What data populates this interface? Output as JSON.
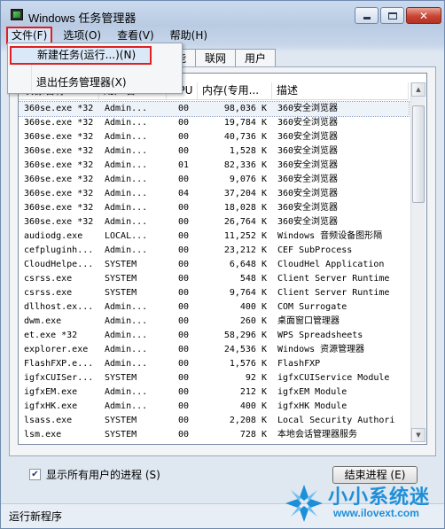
{
  "window": {
    "title": "Windows 任务管理器"
  },
  "menubar": {
    "file": "文件(F)",
    "options": "选项(O)",
    "view": "查看(V)",
    "help": "帮助(H)"
  },
  "tabs": [
    "能",
    "联网",
    "用户"
  ],
  "dropdown": {
    "new_task": "新建任务(运行...)(N)",
    "exit": "退出任务管理器(X)"
  },
  "columns": {
    "name": "映像名称",
    "user": "用户名",
    "cpu": "CPU",
    "memory": "内存(专用...",
    "description": "描述"
  },
  "processes": [
    {
      "name": "360se.exe *32",
      "user": "Admin...",
      "cpu": "00",
      "mem": "98,036 K",
      "desc": "360安全浏览器"
    },
    {
      "name": "360se.exe *32",
      "user": "Admin...",
      "cpu": "00",
      "mem": "19,784 K",
      "desc": "360安全浏览器"
    },
    {
      "name": "360se.exe *32",
      "user": "Admin...",
      "cpu": "00",
      "mem": "40,736 K",
      "desc": "360安全浏览器"
    },
    {
      "name": "360se.exe *32",
      "user": "Admin...",
      "cpu": "00",
      "mem": "1,528 K",
      "desc": "360安全浏览器"
    },
    {
      "name": "360se.exe *32",
      "user": "Admin...",
      "cpu": "01",
      "mem": "82,336 K",
      "desc": "360安全浏览器"
    },
    {
      "name": "360se.exe *32",
      "user": "Admin...",
      "cpu": "00",
      "mem": "9,076 K",
      "desc": "360安全浏览器"
    },
    {
      "name": "360se.exe *32",
      "user": "Admin...",
      "cpu": "04",
      "mem": "37,204 K",
      "desc": "360安全浏览器"
    },
    {
      "name": "360se.exe *32",
      "user": "Admin...",
      "cpu": "00",
      "mem": "18,028 K",
      "desc": "360安全浏览器"
    },
    {
      "name": "360se.exe *32",
      "user": "Admin...",
      "cpu": "00",
      "mem": "26,764 K",
      "desc": "360安全浏览器"
    },
    {
      "name": "audiodg.exe",
      "user": "LOCAL...",
      "cpu": "00",
      "mem": "11,252 K",
      "desc": "Windows 音频设备图形隔"
    },
    {
      "name": "cefpluginh...",
      "user": "Admin...",
      "cpu": "00",
      "mem": "23,212 K",
      "desc": "CEF SubProcess"
    },
    {
      "name": "CloudHelpe...",
      "user": "SYSTEM",
      "cpu": "00",
      "mem": "6,648 K",
      "desc": "CloudHel Application"
    },
    {
      "name": "csrss.exe",
      "user": "SYSTEM",
      "cpu": "00",
      "mem": "548 K",
      "desc": "Client Server Runtime"
    },
    {
      "name": "csrss.exe",
      "user": "SYSTEM",
      "cpu": "00",
      "mem": "9,764 K",
      "desc": "Client Server Runtime"
    },
    {
      "name": "dllhost.ex...",
      "user": "Admin...",
      "cpu": "00",
      "mem": "400 K",
      "desc": "COM Surrogate"
    },
    {
      "name": "dwm.exe",
      "user": "Admin...",
      "cpu": "00",
      "mem": "260 K",
      "desc": "桌面窗口管理器"
    },
    {
      "name": "et.exe *32",
      "user": "Admin...",
      "cpu": "00",
      "mem": "58,296 K",
      "desc": "WPS Spreadsheets"
    },
    {
      "name": "explorer.exe",
      "user": "Admin...",
      "cpu": "00",
      "mem": "24,536 K",
      "desc": "Windows 资源管理器"
    },
    {
      "name": "FlashFXP.e...",
      "user": "Admin...",
      "cpu": "00",
      "mem": "1,576 K",
      "desc": "FlashFXP"
    },
    {
      "name": "igfxCUISer...",
      "user": "SYSTEM",
      "cpu": "00",
      "mem": "92 K",
      "desc": "igfxCUIService Module"
    },
    {
      "name": "igfxEM.exe",
      "user": "Admin...",
      "cpu": "00",
      "mem": "212 K",
      "desc": "igfxEM Module"
    },
    {
      "name": "igfxHK.exe",
      "user": "Admin...",
      "cpu": "00",
      "mem": "400 K",
      "desc": "igfxHK Module"
    },
    {
      "name": "lsass.exe",
      "user": "SYSTEM",
      "cpu": "00",
      "mem": "2,208 K",
      "desc": "Local Security Authori"
    },
    {
      "name": "lsm.exe",
      "user": "SYSTEM",
      "cpu": "00",
      "mem": "728 K",
      "desc": "本地会话管理器服务"
    }
  ],
  "footer": {
    "show_all": "显示所有用户的进程 (S)",
    "end_process": "结束进程 (E)"
  },
  "status": {
    "text": "运行新程序"
  },
  "watermark": {
    "title": "小小系统迷",
    "url": "www.ilovext.com"
  }
}
